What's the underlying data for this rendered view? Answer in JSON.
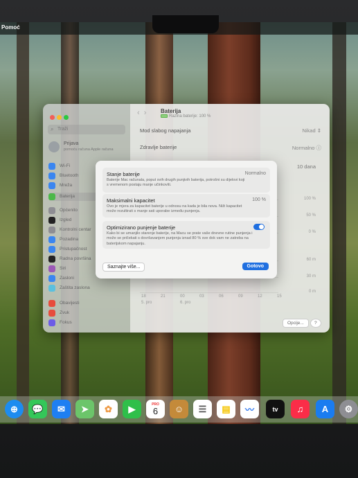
{
  "menubar": {
    "app_menu": "Pomoć"
  },
  "sidebar": {
    "search_placeholder": "Traži",
    "user_name": "Prijava",
    "user_sub": "pomoću računa Apple računa",
    "items": [
      {
        "label": "Wi-Fi",
        "color": "#3a86f0"
      },
      {
        "label": "Bluetooth",
        "color": "#3a86f0"
      },
      {
        "label": "Mreža",
        "color": "#3a86f0"
      },
      {
        "label": "Baterija",
        "color": "#4cb84a"
      },
      {
        "label": "Općenito",
        "color": "#8e8e93"
      },
      {
        "label": "Izgled",
        "color": "#222222"
      },
      {
        "label": "Kontrolni centar",
        "color": "#8e8e93"
      },
      {
        "label": "Pozadina",
        "color": "#3a86f0"
      },
      {
        "label": "Pristupačnost",
        "color": "#3a86f0"
      },
      {
        "label": "Radna površina",
        "color": "#222222"
      },
      {
        "label": "Siri",
        "color": "#9b59b6"
      },
      {
        "label": "Zasloni",
        "color": "#3a86f0"
      },
      {
        "label": "Zaštita zaslona",
        "color": "#5bc0de"
      },
      {
        "label": "Obavijesti",
        "color": "#e74c3c"
      },
      {
        "label": "Zvuk",
        "color": "#e74c3c"
      },
      {
        "label": "Fokus",
        "color": "#6c5ce7"
      }
    ]
  },
  "content": {
    "title": "Baterija",
    "subtitle": "Razina baterije: 100 %",
    "low_power_label": "Mod slabog napajanja",
    "low_power_value": "Nikad",
    "health_label": "Zdravlje baterije",
    "health_value": "Normalno",
    "range_label": "10 dana",
    "y_labels": [
      "100 %",
      "50 %",
      "0 %",
      "60 m",
      "30 m",
      "0 m"
    ],
    "x_labels": [
      "18",
      "21",
      "00",
      "03",
      "06",
      "09",
      "12",
      "15"
    ],
    "date_labels": [
      "5. pro",
      "6. pro"
    ],
    "options_button": "Opcije...",
    "help_button": "?"
  },
  "dialog": {
    "condition_title": "Stanje baterije",
    "condition_value": "Normalno",
    "condition_desc": "Baterije Mac računala, poput svih drugih punjivih baterija, potrošni su dijelovi koji s vremenom postaju manje učinkoviti.",
    "capacity_title": "Maksimalni kapacitet",
    "capacity_value": "100 %",
    "capacity_desc": "Ovo je mjera za kapacitet baterije u odnosu na kada je bila nova. Niži kapacitet može rezultirati s manje sati uporabe između punjenja.",
    "optimized_title": "Optimizirano punjenje baterije",
    "optimized_desc": "Kako bi se umanjilo starenje baterije, na Macu se prate vaše dnevne rutine punjenja i može se pričekati s dovršavanjem punjenja iznad 80 % sve dok vam ne zatreba na baterijskom napajanju.",
    "optimized_enabled": true,
    "learn_more": "Saznajte više...",
    "done": "Gotovo"
  },
  "dock": {
    "calendar_month": "PRO",
    "calendar_day": "6",
    "tv_label": "tv"
  }
}
